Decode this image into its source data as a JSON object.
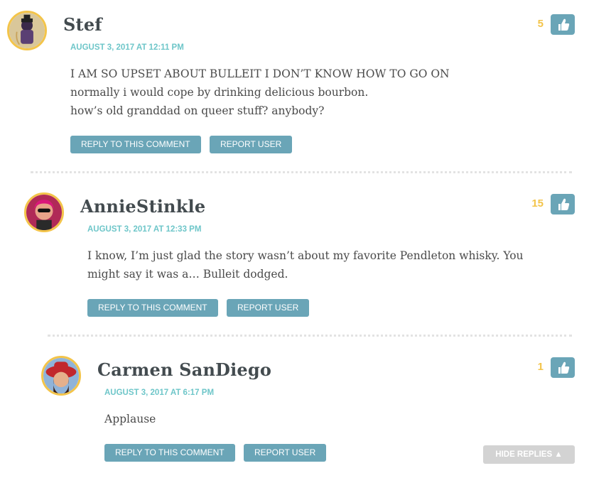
{
  "comments": [
    {
      "author": "Stef",
      "date": "AUGUST 3, 2017 AT 12:11 PM",
      "lines": [
        "I AM SO UPSET ABOUT BULLEIT I DON’T KNOW HOW TO GO ON",
        "normally i would cope by drinking delicious bourbon.",
        "how’s old granddad on queer stuff? anybody?"
      ],
      "votes": "5",
      "reply_label": "REPLY TO THIS COMMENT",
      "report_label": "REPORT USER",
      "avatar_icon": "avatar-stef"
    },
    {
      "author": "AnnieStinkle",
      "date": "AUGUST 3, 2017 AT 12:33 PM",
      "lines": [
        "I know, I’m just glad the story wasn’t about my favorite Pendleton whisky. You might say it was a… Bulleit dodged."
      ],
      "votes": "15",
      "reply_label": "REPLY TO THIS COMMENT",
      "report_label": "REPORT USER",
      "avatar_icon": "avatar-anniestinkle"
    },
    {
      "author": "Carmen SanDiego",
      "date": "AUGUST 3, 2017 AT 6:17 PM",
      "lines": [
        "Applause"
      ],
      "votes": "1",
      "reply_label": "REPLY TO THIS COMMENT",
      "report_label": "REPORT USER",
      "avatar_icon": "avatar-carmen"
    }
  ],
  "hide_replies_label": "HIDE REPLIES ▲",
  "like_icon": "thumbs-up-icon",
  "colors": {
    "accent_teal": "#6aa5b7",
    "date_teal": "#6ec6c9",
    "vote_gold": "#f3c44a",
    "author_text": "#434b4f",
    "hide_gray": "#d3d3d3"
  }
}
